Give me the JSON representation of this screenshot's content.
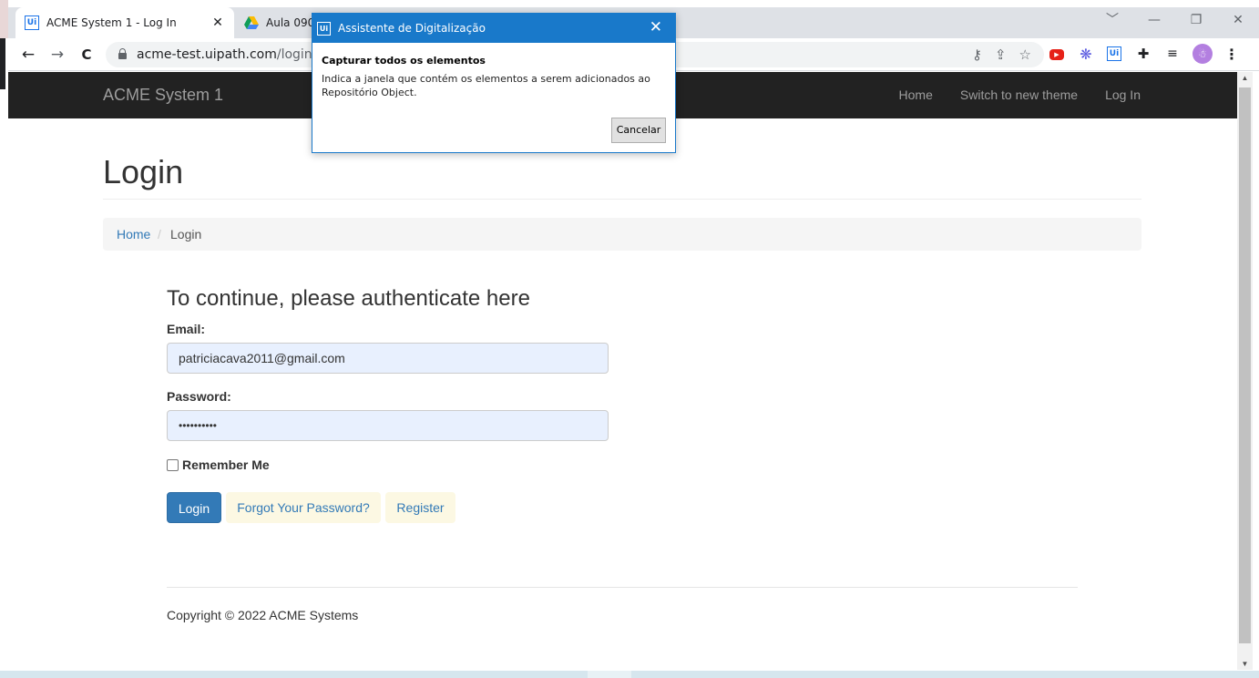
{
  "browser": {
    "tabs": [
      {
        "title": "ACME System 1 - Log In",
        "close": "✕"
      },
      {
        "title": "Aula 0903"
      }
    ],
    "window_controls": {
      "dropdown": "﹀",
      "minimize": "—",
      "restore": "❐",
      "close": "✕"
    },
    "nav": {
      "back": "←",
      "forward": "→",
      "reload": "C"
    },
    "address": {
      "host": "acme-test.uipath.com",
      "path": "/login"
    },
    "omnibox_icons": {
      "key": "⚷",
      "share": "⇪",
      "star": "☆"
    },
    "extensions": {
      "youtube": "▶",
      "flower": "❋",
      "uipath": "Ui",
      "puzzle": "✚",
      "queue": "≡",
      "avatar": "☃",
      "menu": "⋮"
    }
  },
  "navbar": {
    "brand": "ACME System 1",
    "links": [
      "Home",
      "Switch to new theme",
      "Log In"
    ]
  },
  "page": {
    "title": "Login",
    "breadcrumb": {
      "home": "Home",
      "separator": "/",
      "current": "Login"
    },
    "form": {
      "heading": "To continue, please authenticate here",
      "email_label": "Email:",
      "email_value": "patriciacava2011@gmail.com",
      "password_label": "Password:",
      "password_value": "••••••••••",
      "remember_label": "Remember Me",
      "login_button": "Login",
      "forgot_link": "Forgot Your Password?",
      "register_link": "Register"
    },
    "footer": "Copyright © 2022 ACME Systems"
  },
  "scrollbar": {
    "up": "▲",
    "down": "▼"
  },
  "dialog": {
    "logo": "Ui",
    "title": "Assistente de Digitalização",
    "close": "✕",
    "heading": "Capturar todos os elementos",
    "text": "Indica a janela que contém os elementos a serem adicionados ao Repositório Object.",
    "cancel_button": "Cancelar"
  },
  "colors": {
    "navbar_bg": "#222222",
    "link": "#337ab7",
    "primary_button": "#337ab7",
    "dialog_accent": "#1979ca",
    "autofill_bg": "#e8f0fe"
  }
}
